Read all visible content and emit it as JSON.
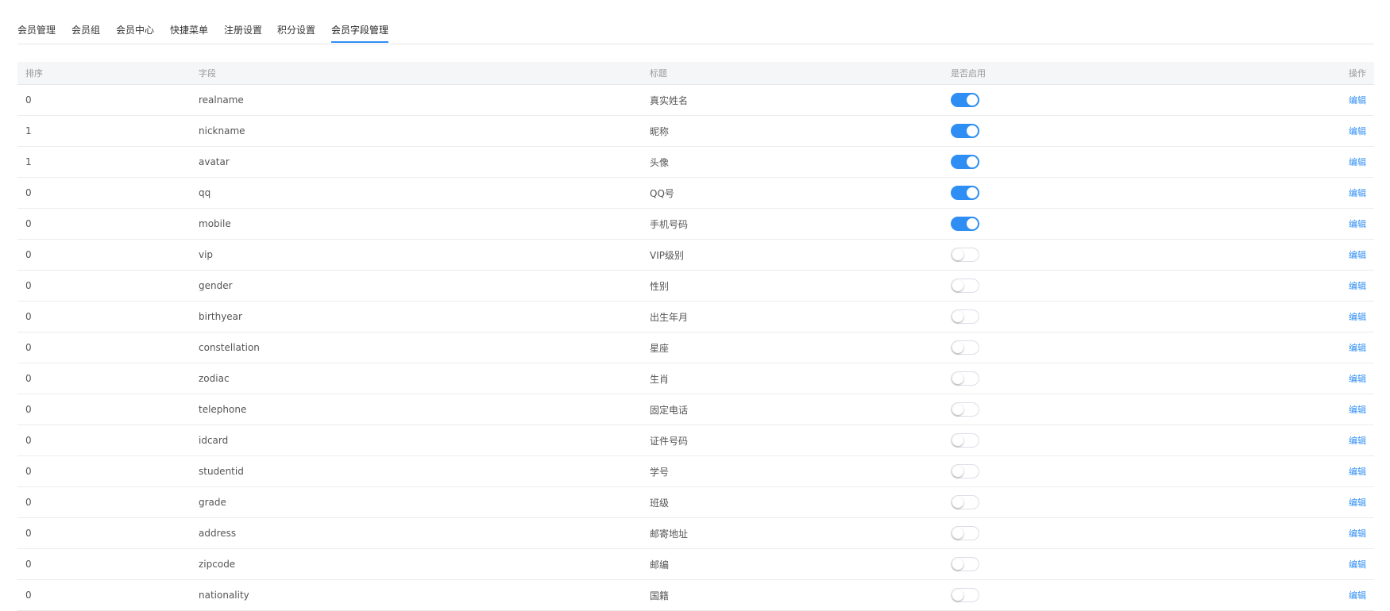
{
  "tabs": [
    {
      "label": "会员管理",
      "active": false
    },
    {
      "label": "会员组",
      "active": false
    },
    {
      "label": "会员中心",
      "active": false
    },
    {
      "label": "快捷菜单",
      "active": false
    },
    {
      "label": "注册设置",
      "active": false
    },
    {
      "label": "积分设置",
      "active": false
    },
    {
      "label": "会员字段管理",
      "active": true
    }
  ],
  "table": {
    "columns": {
      "sort": "排序",
      "field": "字段",
      "title": "标题",
      "enabled": "是否启用",
      "action": "操作"
    },
    "action_label": "编辑",
    "rows": [
      {
        "sort": "0",
        "field": "realname",
        "title": "真实姓名",
        "enabled": true
      },
      {
        "sort": "1",
        "field": "nickname",
        "title": "昵称",
        "enabled": true
      },
      {
        "sort": "1",
        "field": "avatar",
        "title": "头像",
        "enabled": true
      },
      {
        "sort": "0",
        "field": "qq",
        "title": "QQ号",
        "enabled": true
      },
      {
        "sort": "0",
        "field": "mobile",
        "title": "手机号码",
        "enabled": true
      },
      {
        "sort": "0",
        "field": "vip",
        "title": "VIP级别",
        "enabled": false
      },
      {
        "sort": "0",
        "field": "gender",
        "title": "性别",
        "enabled": false
      },
      {
        "sort": "0",
        "field": "birthyear",
        "title": "出生年月",
        "enabled": false
      },
      {
        "sort": "0",
        "field": "constellation",
        "title": "星座",
        "enabled": false
      },
      {
        "sort": "0",
        "field": "zodiac",
        "title": "生肖",
        "enabled": false
      },
      {
        "sort": "0",
        "field": "telephone",
        "title": "固定电话",
        "enabled": false
      },
      {
        "sort": "0",
        "field": "idcard",
        "title": "证件号码",
        "enabled": false
      },
      {
        "sort": "0",
        "field": "studentid",
        "title": "学号",
        "enabled": false
      },
      {
        "sort": "0",
        "field": "grade",
        "title": "班级",
        "enabled": false
      },
      {
        "sort": "0",
        "field": "address",
        "title": "邮寄地址",
        "enabled": false
      },
      {
        "sort": "0",
        "field": "zipcode",
        "title": "邮编",
        "enabled": false
      },
      {
        "sort": "0",
        "field": "nationality",
        "title": "国籍",
        "enabled": false
      }
    ]
  },
  "colors": {
    "accent": "#2f8ef4"
  }
}
